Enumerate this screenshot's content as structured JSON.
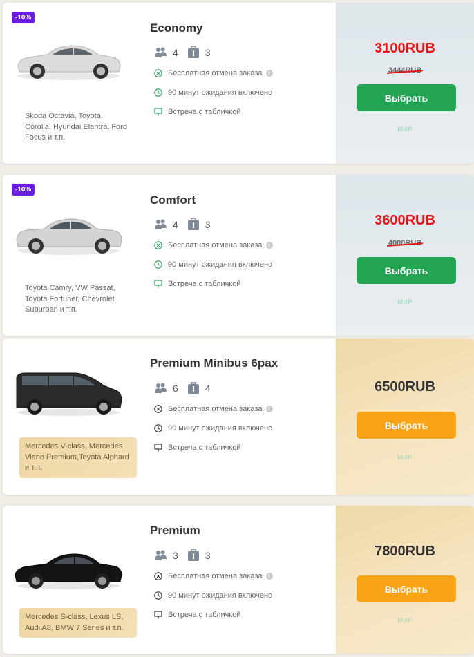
{
  "colors": {
    "discount_badge": "#6b1fe0",
    "discount_price": "#e51414",
    "standard_button": "#22a654",
    "premium_button": "#f9a417",
    "feature_icon_green": "#2aa35a",
    "feature_icon_dark": "#333333"
  },
  "cards": [
    {
      "badge": "-10%",
      "class_name": "Economy",
      "passengers": "4",
      "luggage": "3",
      "features": [
        "Бесплатная отмена заказа",
        "90 минут ожидания включено",
        "Встреча с табличкой"
      ],
      "models": "Skoda Octavia, Toyota Corolla, Hyundai Elantra, Ford Focus и т.п.",
      "price": "3100RUB",
      "old_price": "3444RUB",
      "button_label": "Выбрать",
      "payment_logo": "МИР",
      "car_color": "#d9d9d9"
    },
    {
      "badge": "-10%",
      "class_name": "Comfort",
      "passengers": "4",
      "luggage": "3",
      "features": [
        "Бесплатная отмена заказа",
        "90 минут ожидания включено",
        "Встреча с табличкой"
      ],
      "models": "Toyota Camry, VW Passat, Toyota Fortuner, Chevrolet Suburban и т.п.",
      "price": "3600RUB",
      "old_price": "4000RUB",
      "button_label": "Выбрать",
      "payment_logo": "МИР",
      "car_color": "#cfcfcf"
    },
    {
      "class_name": "Premium Minibus 6pax",
      "passengers": "6",
      "luggage": "4",
      "features": [
        "Бесплатная отмена заказа",
        "90 минут ожидания включено",
        "Встреча с табличкой"
      ],
      "models": "Mercedes V-class, Mercedes Viano Premium,Toyota Alphard и т.п.",
      "price": "6500RUB",
      "button_label": "Выбрать",
      "payment_logo": "МИР",
      "car_color": "#2b2b2b"
    },
    {
      "class_name": "Premium",
      "passengers": "3",
      "luggage": "3",
      "features": [
        "Бесплатная отмена заказа",
        "90 минут ожидания включено",
        "Встреча с табличкой"
      ],
      "models": "Mercedes S-class, Lexus LS, Audi A8, BMW 7 Series и т.п.",
      "price": "7800RUB",
      "button_label": "Выбрать",
      "payment_logo": "МИР",
      "car_color": "#111111"
    }
  ]
}
